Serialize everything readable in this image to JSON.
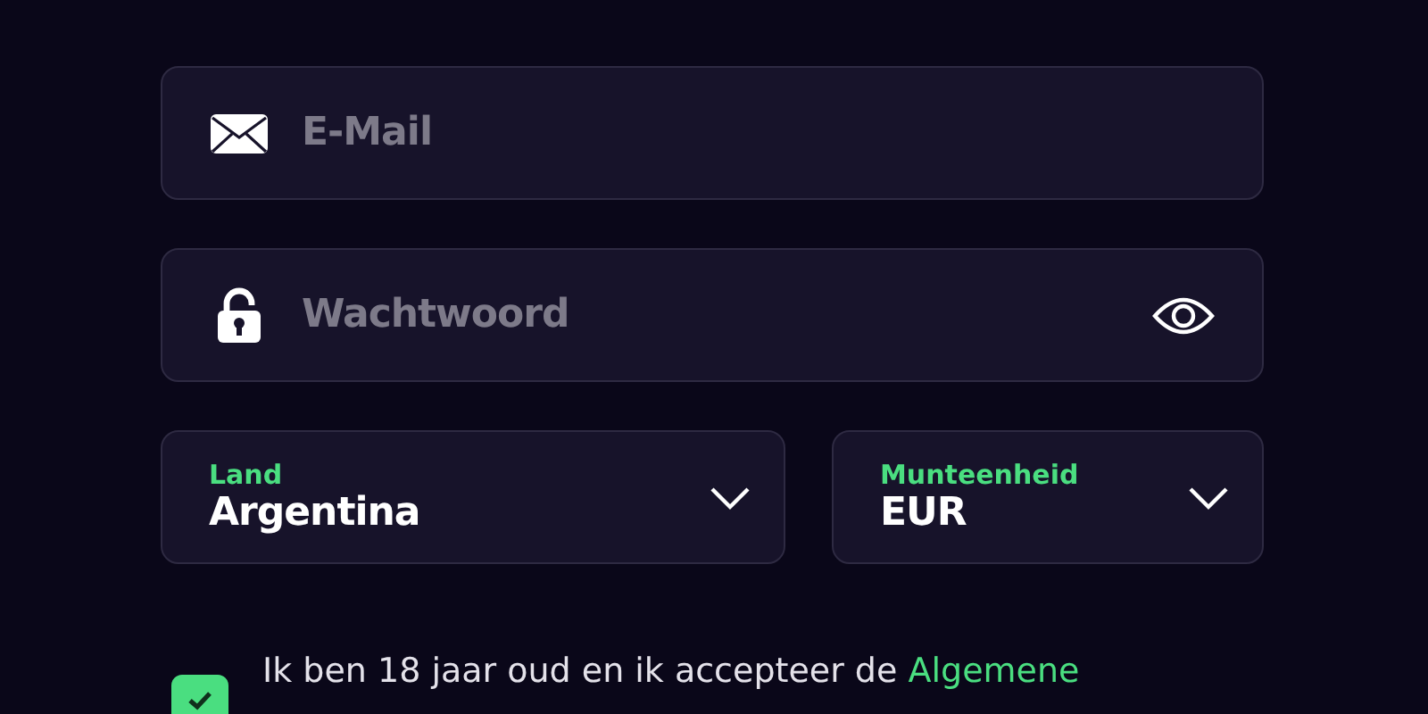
{
  "email": {
    "placeholder": "E-Mail"
  },
  "password": {
    "placeholder": "Wachtwoord"
  },
  "selects": [
    {
      "label": "Land",
      "value": "Argentina"
    },
    {
      "label": "Munteenheid",
      "value": "EUR"
    }
  ],
  "consent": {
    "checked": true,
    "text": "Ik ben 18 jaar oud en ik accepteer de ",
    "link": "Algemene"
  }
}
